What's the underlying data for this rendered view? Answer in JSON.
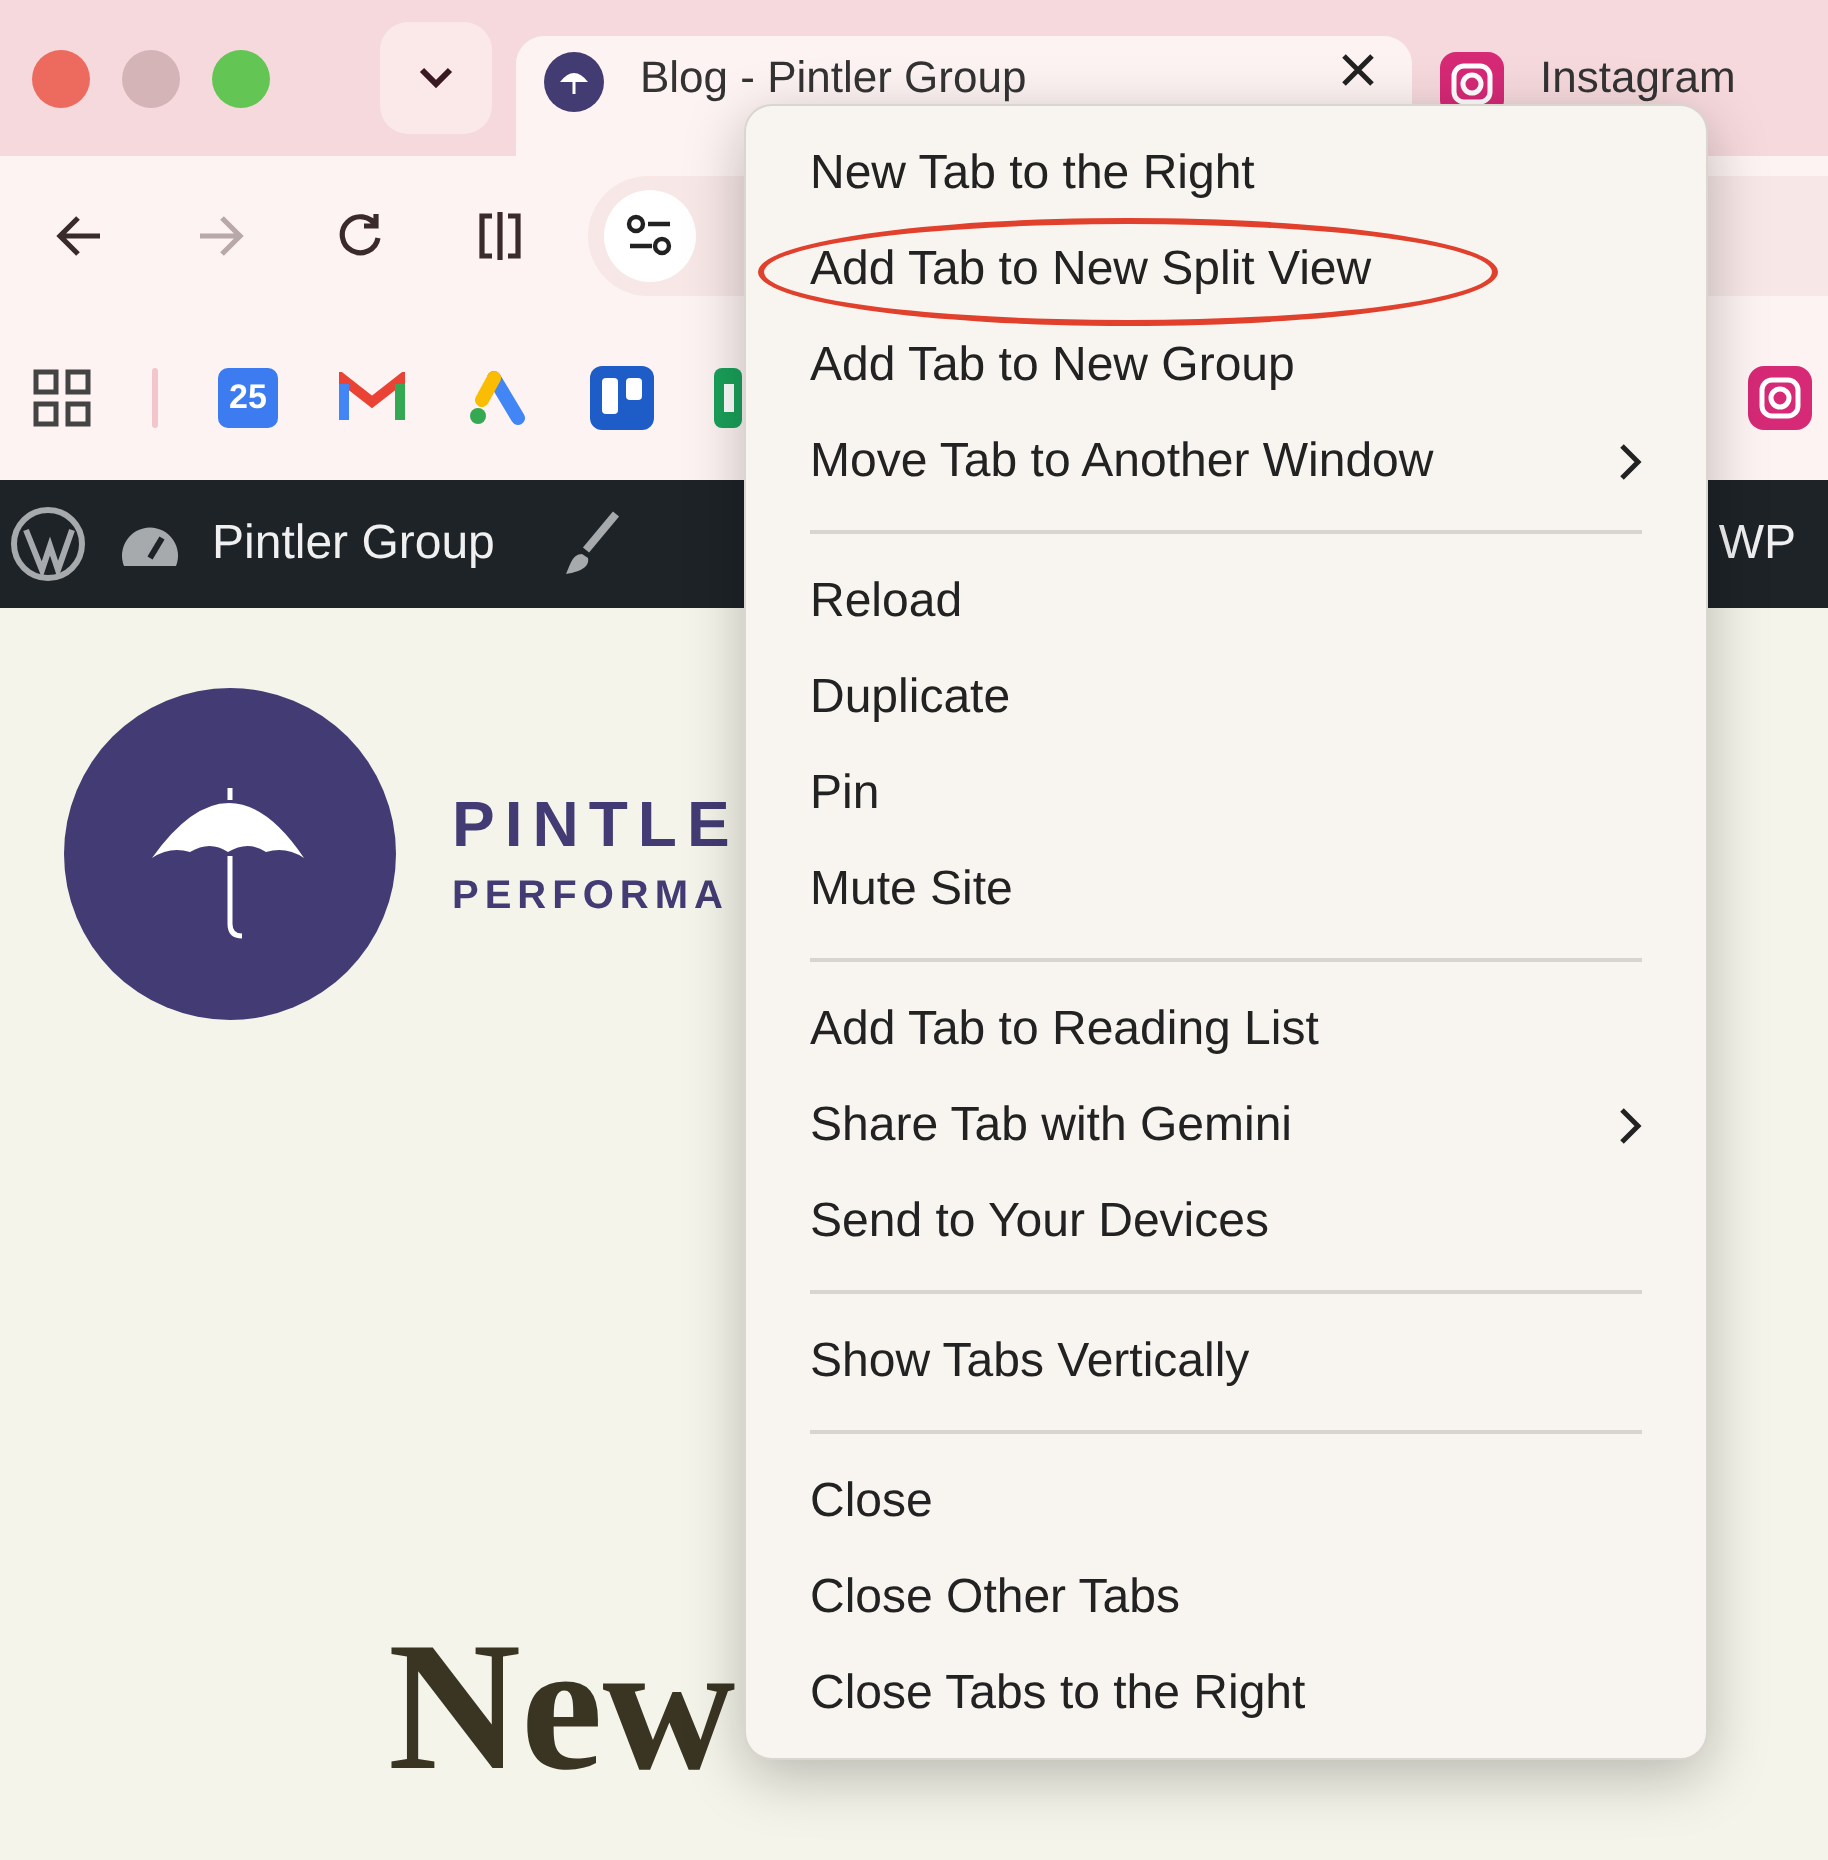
{
  "tabs": [
    {
      "title": "Blog - Pintler Group",
      "kind": "site",
      "selected": true
    },
    {
      "title": "Instagram",
      "kind": "social",
      "selected": false
    }
  ],
  "toolbar": [
    {
      "kind": "back",
      "disabled": false
    },
    {
      "kind": "forward",
      "disabled": true
    },
    {
      "kind": "reload",
      "disabled": false
    },
    {
      "kind": "split",
      "disabled": false
    }
  ],
  "bookmarks": [
    {
      "kind": "apps"
    },
    {
      "kind": "divider"
    },
    {
      "kind": "calendar",
      "label": "25"
    },
    {
      "kind": "mail"
    },
    {
      "kind": "ads"
    },
    {
      "kind": "board"
    },
    {
      "kind": "green"
    }
  ],
  "admin_bar": {
    "site": "Pintler Group",
    "right": "WP"
  },
  "logo": {
    "line_1": "PINTLE",
    "line_2": "PERFORMA"
  },
  "heading": "New",
  "menu": [
    {
      "items": [
        {
          "label": "New Tab to the Right",
          "submenu": false,
          "circled": false
        },
        {
          "label": "Add Tab to New Split View",
          "submenu": false,
          "circled": true
        },
        {
          "label": "Add Tab to New Group",
          "submenu": false,
          "circled": false
        },
        {
          "label": "Move Tab to Another Window",
          "submenu": true,
          "circled": false
        }
      ]
    },
    {
      "items": [
        {
          "label": "Reload",
          "submenu": false,
          "circled": false
        },
        {
          "label": "Duplicate",
          "submenu": false,
          "circled": false
        },
        {
          "label": "Pin",
          "submenu": false,
          "circled": false
        },
        {
          "label": "Mute Site",
          "submenu": false,
          "circled": false
        }
      ]
    },
    {
      "items": [
        {
          "label": "Add Tab to Reading List",
          "submenu": false,
          "circled": false
        },
        {
          "label": "Share Tab with Gemini",
          "submenu": true,
          "circled": false
        },
        {
          "label": "Send to Your Devices",
          "submenu": false,
          "circled": false
        }
      ]
    },
    {
      "items": [
        {
          "label": "Show Tabs Vertically",
          "submenu": false,
          "circled": false
        }
      ]
    },
    {
      "items": [
        {
          "label": "Close",
          "submenu": false,
          "circled": false
        },
        {
          "label": "Close Other Tabs",
          "submenu": false,
          "circled": false
        },
        {
          "label": "Close Tabs to the Right",
          "submenu": false,
          "circled": false
        }
      ]
    }
  ]
}
